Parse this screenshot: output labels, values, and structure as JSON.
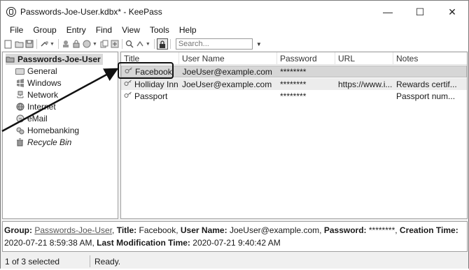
{
  "window": {
    "title": "Passwords-Joe-User.kdbx* - KeePass",
    "minimize": "—",
    "maximize": "☐",
    "close": "✕"
  },
  "menu": [
    "File",
    "Group",
    "Entry",
    "Find",
    "View",
    "Tools",
    "Help"
  ],
  "toolbar": {
    "search_placeholder": "Search...",
    "lock_symbol": "🔒"
  },
  "tree": {
    "root": "Passwords-Joe-User",
    "groups": [
      {
        "label": "General",
        "icon": "folder-icon",
        "italic": false
      },
      {
        "label": "Windows",
        "icon": "windows-icon",
        "italic": false
      },
      {
        "label": "Network",
        "icon": "network-icon",
        "italic": false
      },
      {
        "label": "Internet",
        "icon": "globe-icon",
        "italic": false
      },
      {
        "label": "eMail",
        "icon": "mail-icon",
        "italic": false
      },
      {
        "label": "Homebanking",
        "icon": "bank-icon",
        "italic": false
      },
      {
        "label": "Recycle Bin",
        "icon": "trash-icon",
        "italic": true
      }
    ]
  },
  "list": {
    "columns": [
      "Title",
      "User Name",
      "Password",
      "URL",
      "Notes"
    ],
    "rows": [
      {
        "title": "Facebook",
        "user": "JoeUser@example.com",
        "password": "********",
        "url": "",
        "notes": "",
        "selected": true
      },
      {
        "title": "Holliday Inn",
        "user": "JoeUser@example.com",
        "password": "********",
        "url": "https://www.i...",
        "notes": "Rewards certif...",
        "selected": false
      },
      {
        "title": "Passport",
        "user": "",
        "password": "********",
        "url": "",
        "notes": "Passport num...",
        "selected": false
      }
    ]
  },
  "details": {
    "group_label": "Group:",
    "group_value": "Passwords-Joe-User",
    "title_label": "Title:",
    "title_value": "Facebook",
    "user_label": "User Name:",
    "user_value": "JoeUser@example.com",
    "password_label": "Password:",
    "password_value": "********",
    "created_label": "Creation Time:",
    "created_value_part1": "2020-07-21",
    "created_value_part2": "8:59:38 AM",
    "modified_label": "Last Modification Time:",
    "modified_value": "2020-07-21 9:40:42 AM"
  },
  "status": {
    "selection": "1 of 3 selected",
    "state": "Ready."
  }
}
